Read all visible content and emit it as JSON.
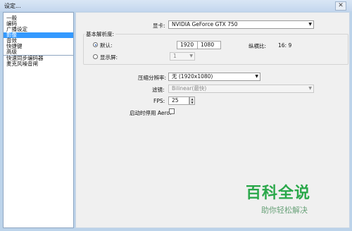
{
  "window": {
    "title": "设定..."
  },
  "sidebar": {
    "items": [
      {
        "label": "一般"
      },
      {
        "label": "编码"
      },
      {
        "label": "广播设定"
      },
      {
        "label": "影像"
      },
      {
        "label": "音效"
      },
      {
        "label": "快捷键"
      },
      {
        "label": "高级"
      },
      {
        "label": "快速同步编码器"
      },
      {
        "label": "麦克风噪音闸"
      }
    ],
    "selected": "影像"
  },
  "video": {
    "graphics_card": {
      "label": "显卡:",
      "value": "NVIDIA GeForce GTX 750"
    },
    "base_resolution": {
      "group_label": "基本解析度:",
      "default_label": "默认:",
      "width": "1920",
      "height": "1080",
      "aspect_label": "纵横比:",
      "aspect_value": "16: 9",
      "monitor_label": "显示屏:",
      "monitor_value": "1"
    },
    "downscale": {
      "label": "压缩分辨率:",
      "value": "无 (1920x1080)"
    },
    "filter": {
      "label": "滤镜:",
      "value": "Bilinear(最快)"
    },
    "fps": {
      "label": "FPS:",
      "value": "25"
    },
    "aero": {
      "label": "启动时停用 Aero:"
    }
  },
  "watermark": {
    "main": "百科全说",
    "sub": "助你轻松解决"
  }
}
